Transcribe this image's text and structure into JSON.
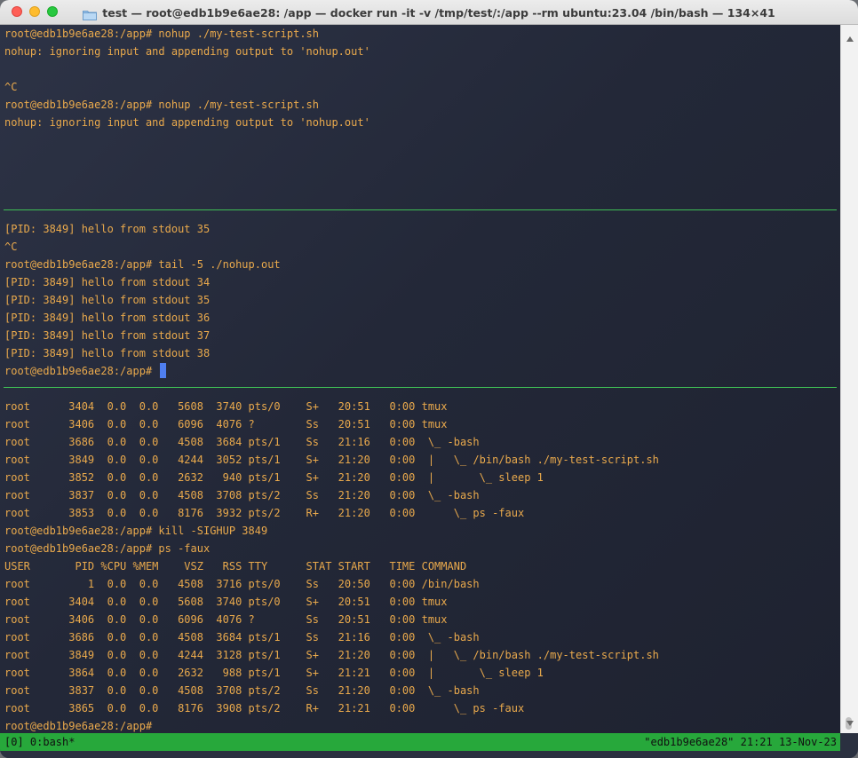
{
  "window": {
    "title": "test — root@edb1b9e6ae28: /app — docker run -it -v /tmp/test/:/app --rm ubuntu:23.04 /bin/bash — 134×41"
  },
  "panes": {
    "top": [
      "root@edb1b9e6ae28:/app# nohup ./my-test-script.sh",
      "nohup: ignoring input and appending output to 'nohup.out'",
      "",
      "^C",
      "root@edb1b9e6ae28:/app# nohup ./my-test-script.sh",
      "nohup: ignoring input and appending output to 'nohup.out'"
    ],
    "middle": [
      "[PID: 3849] hello from stdout 35",
      "^C",
      "root@edb1b9e6ae28:/app# tail -5 ./nohup.out",
      "[PID: 3849] hello from stdout 34",
      "[PID: 3849] hello from stdout 35",
      "[PID: 3849] hello from stdout 36",
      "[PID: 3849] hello from stdout 37",
      "[PID: 3849] hello from stdout 38"
    ],
    "middle_prompt": "root@edb1b9e6ae28:/app# ",
    "bottom": [
      "root      3404  0.0  0.0   5608  3740 pts/0    S+   20:51   0:00 tmux",
      "root      3406  0.0  0.0   6096  4076 ?        Ss   20:51   0:00 tmux",
      "root      3686  0.0  0.0   4508  3684 pts/1    Ss   21:16   0:00  \\_ -bash",
      "root      3849  0.0  0.0   4244  3052 pts/1    S+   21:20   0:00  |   \\_ /bin/bash ./my-test-script.sh",
      "root      3852  0.0  0.0   2632   940 pts/1    S+   21:20   0:00  |       \\_ sleep 1",
      "root      3837  0.0  0.0   4508  3708 pts/2    Ss   21:20   0:00  \\_ -bash",
      "root      3853  0.0  0.0   8176  3932 pts/2    R+   21:20   0:00      \\_ ps -faux",
      "root@edb1b9e6ae28:/app# kill -SIGHUP 3849",
      "root@edb1b9e6ae28:/app# ps -faux",
      "USER       PID %CPU %MEM    VSZ   RSS TTY      STAT START   TIME COMMAND",
      "root         1  0.0  0.0   4508  3716 pts/0    Ss   20:50   0:00 /bin/bash",
      "root      3404  0.0  0.0   5608  3740 pts/0    S+   20:51   0:00 tmux",
      "root      3406  0.0  0.0   6096  4076 ?        Ss   20:51   0:00 tmux",
      "root      3686  0.0  0.0   4508  3684 pts/1    Ss   21:16   0:00  \\_ -bash",
      "root      3849  0.0  0.0   4244  3128 pts/1    S+   21:20   0:00  |   \\_ /bin/bash ./my-test-script.sh",
      "root      3864  0.0  0.0   2632   988 pts/1    S+   21:21   0:00  |       \\_ sleep 1",
      "root      3837  0.0  0.0   4508  3708 pts/2    Ss   21:20   0:00  \\_ -bash",
      "root      3865  0.0  0.0   8176  3908 pts/2    R+   21:21   0:00      \\_ ps -faux",
      "root@edb1b9e6ae28:/app#"
    ]
  },
  "status": {
    "left": "[0] 0:bash*",
    "right": "\"edb1b9e6ae28\" 21:21 13-Nov-23"
  },
  "colors": {
    "terminal_text": "#e9a94c",
    "pane_separator": "#3fbf55",
    "status_bar": "#27a83b",
    "cursor": "#4f7ff0"
  }
}
